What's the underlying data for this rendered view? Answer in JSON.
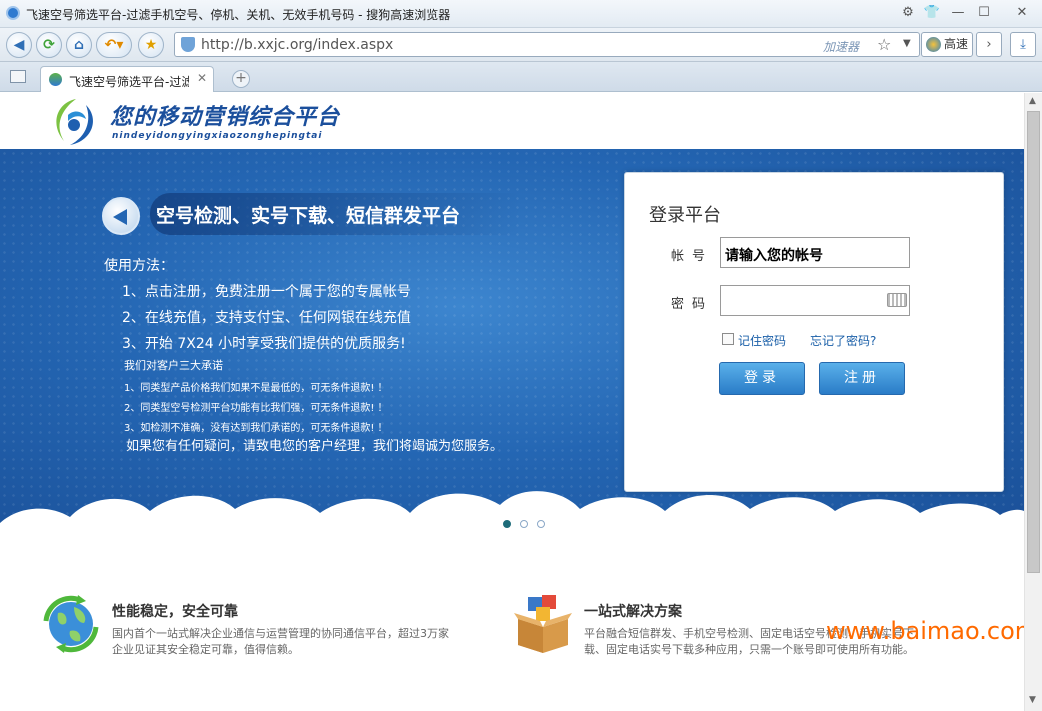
{
  "browser": {
    "window_title": "飞速空号筛选平台-过滤手机空号、停机、关机、无效手机号码 - 搜狗高速浏览器",
    "url": "http://b.xxjc.org/index.aspx",
    "accelerator_label": "加速器",
    "speed_label": "高速",
    "tab_title": "飞速空号筛选平台-过滤手机空号、停机、关机、无效手机号码",
    "controls": {
      "minimize": "—",
      "maximize": "☐",
      "close": "✕"
    }
  },
  "header": {
    "logo_title": "您的移动营销综合平台",
    "logo_subtitle": "nindeyidongyingxiaozonghepingtai"
  },
  "banner": {
    "headline": "空号检测、实号下载、短信群发平台",
    "usage_title": "使用方法：",
    "usage_steps": [
      "1、点击注册，免费注册一个属于您的专属帐号",
      "2、在线充值，支持支付宝、任何网银在线充值",
      "3、开始 7X24 小时享受我们提供的优质服务!"
    ],
    "promise_title": "我们对客户三大承诺",
    "promises": [
      "1、同类型产品价格我们如果不是最低的，可无条件退款! ！",
      "2、同类型空号检测平台功能有比我们强，可无条件退款! ！",
      "3、如检测不准确，没有达到我们承诺的，可无条件退款! ！"
    ],
    "contact": "如果您有任何疑问，请致电您的客户经理，我们将竭诚为您服务。"
  },
  "login": {
    "title": "登录平台",
    "account_label": "帐号",
    "account_value": "请输入您的帐号",
    "password_label": "密码",
    "password_value": "",
    "remember_label": "记住密码",
    "forgot_label": "忘记了密码?",
    "login_button": "登录",
    "register_button": "注册"
  },
  "features": [
    {
      "icon": "globe-refresh-icon",
      "title": "性能稳定，安全可靠",
      "desc": "国内首个一站式解决企业通信与运营管理的协同通信平台，超过3万家企业见证其安全稳定可靠，值得信赖。"
    },
    {
      "icon": "box-apps-icon",
      "title": "一站式解决方案",
      "desc": "平台融合短信群发、手机空号检测、固定电话空号检测、手机实号下载、固定电话实号下载多种应用，只需一个账号即可使用所有功能。"
    }
  ],
  "watermark": "www.baimao.com",
  "colors": {
    "banner_blue": "#2466b3",
    "link_blue": "#1a5fa8",
    "button_blue": "#3a90d8",
    "watermark_orange": "#ff6a00"
  }
}
